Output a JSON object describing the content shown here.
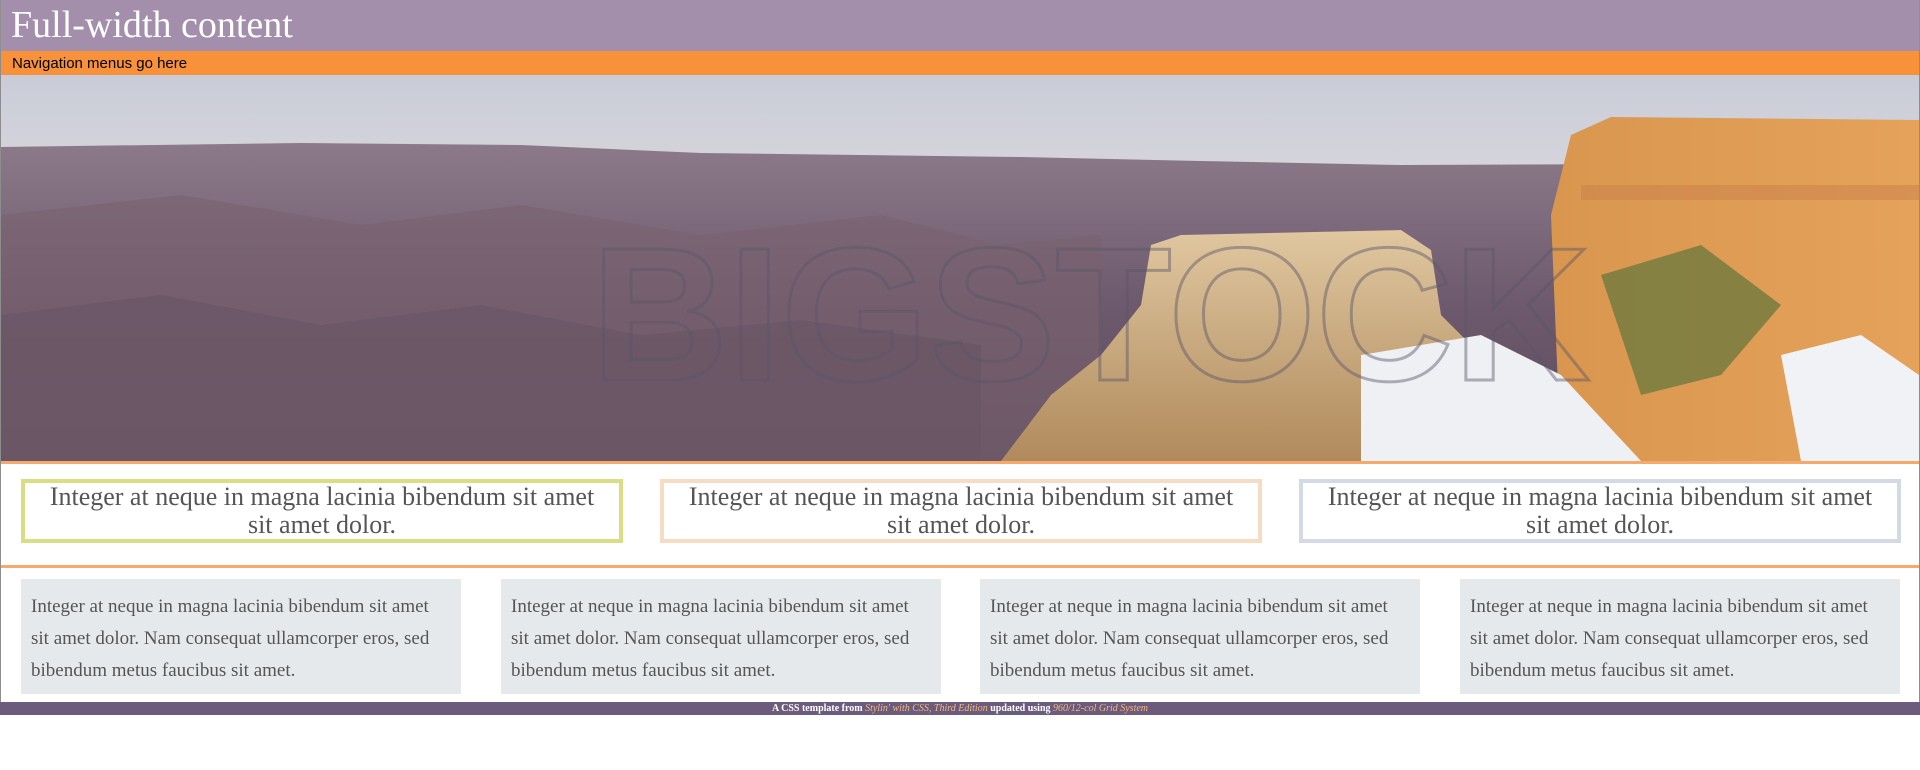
{
  "header": {
    "title": "Full-width content"
  },
  "nav": {
    "text": "Navigation menus go here"
  },
  "hero": {
    "watermark": "BIGSTOCK",
    "description_icon": "canyon-landscape-image"
  },
  "features": [
    {
      "text": "Integer at neque in magna lacinia bibendum sit amet sit amet dolor.",
      "border": "#d9dd84"
    },
    {
      "text": "Integer at neque in magna lacinia bibendum sit amet sit amet dolor.",
      "border": "#f7dcc4"
    },
    {
      "text": "Integer at neque in magna lacinia bibendum sit amet sit amet dolor.",
      "border": "#d3dae6"
    }
  ],
  "columns": [
    {
      "text": "Integer at neque in magna lacinia bibendum sit amet sit amet dolor. Nam consequat ullamcorper eros, sed bibendum metus faucibus sit amet."
    },
    {
      "text": "Integer at neque in magna lacinia bibendum sit amet sit amet dolor. Nam consequat ullamcorper eros, sed bibendum metus faucibus sit amet."
    },
    {
      "text": "Integer at neque in magna lacinia bibendum sit amet sit amet dolor. Nam consequat ullamcorper eros, sed bibendum metus faucibus sit amet."
    },
    {
      "text": "Integer at neque in magna lacinia bibendum sit amet sit amet dolor. Nam consequat ullamcorper eros, sed bibendum metus faucibus sit amet."
    }
  ],
  "footer": {
    "prefix": "A CSS template from",
    "book_link": "Stylin' with CSS, Third Edition",
    "middle": "updated using",
    "grid_link": "960/12-col Grid System"
  },
  "colors": {
    "header_bg": "#a38fab",
    "nav_bg": "#f8923a",
    "footer_bg": "#6c5b7b",
    "column_bg": "#e6e9ec"
  }
}
